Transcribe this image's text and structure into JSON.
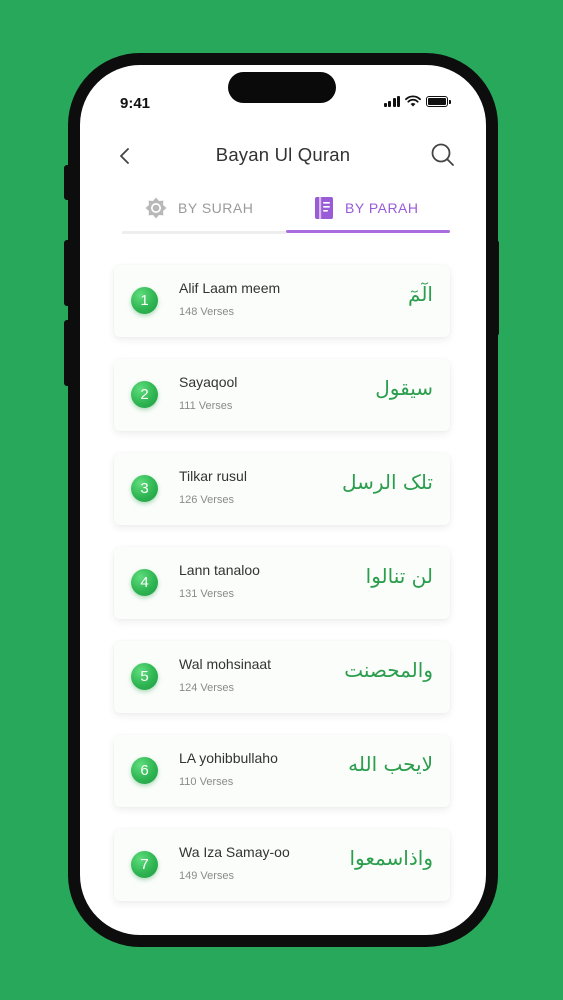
{
  "colors": {
    "background": "#27a85a",
    "accent_purple": "#a96de0",
    "badge_green": "#2fb552",
    "arabic_green": "#2a9e4d"
  },
  "status_bar": {
    "time": "9:41",
    "icons": [
      "cellular-signal-icon",
      "wifi-icon",
      "battery-icon"
    ]
  },
  "header": {
    "title": "Bayan Ul Quran",
    "back_icon": "chevron-left-icon",
    "search_icon": "search-icon"
  },
  "tabs": [
    {
      "label": "BY SURAH",
      "icon": "star-octagon-icon",
      "active": false
    },
    {
      "label": "BY PARAH",
      "icon": "book-icon",
      "active": true
    }
  ],
  "parahs": [
    {
      "number": "1",
      "name": "Alif Laam meem",
      "verses": "148 Verses",
      "arabic": "الٓمٓ"
    },
    {
      "number": "2",
      "name": "Sayaqool",
      "verses": "111 Verses",
      "arabic": "سیقول"
    },
    {
      "number": "3",
      "name": "Tilkar rusul",
      "verses": "126 Verses",
      "arabic": "تلک الرسل"
    },
    {
      "number": "4",
      "name": "Lann tanaloo",
      "verses": "131 Verses",
      "arabic": "لن تنالوا"
    },
    {
      "number": "5",
      "name": "Wal mohsinaat",
      "verses": "124 Verses",
      "arabic": "والمحصنت"
    },
    {
      "number": "6",
      "name": "LA yohibbullaho",
      "verses": "110 Verses",
      "arabic": "لایحب الله"
    },
    {
      "number": "7",
      "name": "Wa Iza Samay-oo",
      "verses": "149 Verses",
      "arabic": "واذاسمعوا"
    }
  ]
}
